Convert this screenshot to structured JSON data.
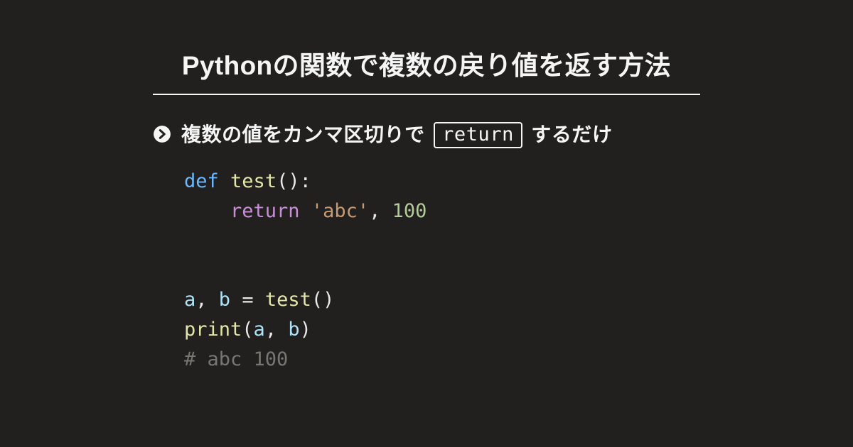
{
  "title": "Pythonの関数で複数の戻り値を返す方法",
  "subtitle": {
    "pre": "複数の値をカンマ区切りで ",
    "keyword": "return",
    "post": " するだけ"
  },
  "code": {
    "line1": {
      "def": "def",
      "sp1": " ",
      "name": "test",
      "parens": "()",
      "colon": ":"
    },
    "line2": {
      "indent": "    ",
      "ret": "return",
      "sp": " ",
      "str": "'abc'",
      "comma": ",",
      "sp2": " ",
      "num": "100"
    },
    "line3": "",
    "line4": "",
    "line5": {
      "a": "a",
      "c1": ",",
      "sp1": " ",
      "b": "b",
      "sp2": " ",
      "eq": "=",
      "sp3": " ",
      "call": "test",
      "parens": "()"
    },
    "line6": {
      "fn": "print",
      "lp": "(",
      "a": "a",
      "comma": ",",
      "sp": " ",
      "b": "b",
      "rp": ")"
    },
    "line7": {
      "comment": "# abc 100"
    }
  }
}
